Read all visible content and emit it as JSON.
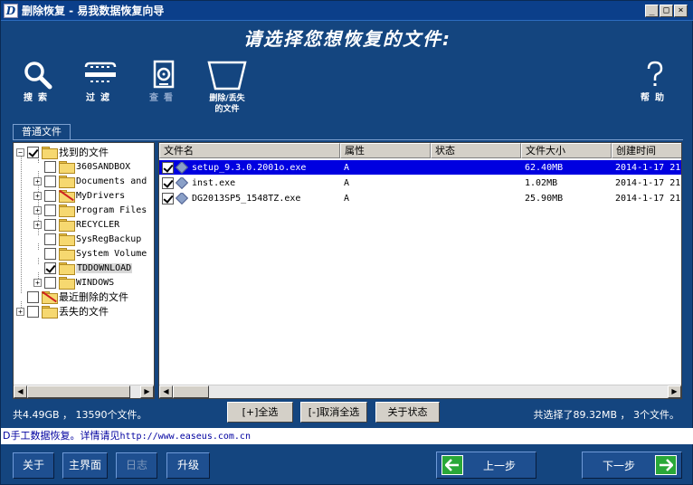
{
  "window": {
    "title": "删除恢复 - 易我数据恢复向导",
    "icon_letter": "D",
    "controls": [
      "_",
      "□",
      "×"
    ]
  },
  "banner": {
    "title": "请选择您想恢复的文件:"
  },
  "toolbar": {
    "search": {
      "label": "搜索",
      "icon": "magnifier-icon"
    },
    "filter": {
      "label": "过滤",
      "icon": "filter-icon"
    },
    "view": {
      "label": "查看",
      "icon": "view-disk-icon",
      "disabled": true
    },
    "deleted_lost": {
      "label_line1": "删除/丢失",
      "label_line2": "的文件",
      "icon": "funnel-icon"
    },
    "help": {
      "label": "帮助",
      "icon": "question-icon"
    }
  },
  "tab": {
    "label": "普通文件"
  },
  "tree": {
    "root_found": "找到的文件",
    "children": [
      {
        "label": "360SANDBOX",
        "expander": "none",
        "checked": false,
        "red": false
      },
      {
        "label": "Documents and",
        "expander": "+",
        "checked": false,
        "red": false
      },
      {
        "label": "MyDrivers",
        "expander": "+",
        "checked": false,
        "red": true
      },
      {
        "label": "Program Files",
        "expander": "+",
        "checked": false,
        "red": false
      },
      {
        "label": "RECYCLER",
        "expander": "+",
        "checked": false,
        "red": false
      },
      {
        "label": "SysRegBackup",
        "expander": "none",
        "checked": false,
        "red": false
      },
      {
        "label": "System Volume",
        "expander": "none",
        "checked": false,
        "red": false
      },
      {
        "label": "TDDOWNLOAD",
        "expander": "none",
        "checked": true,
        "red": false
      },
      {
        "label": "WINDOWS",
        "expander": "+",
        "checked": false,
        "red": false
      }
    ],
    "recent_deleted": "最近删除的文件",
    "lost_files": "丢失的文件"
  },
  "file_list": {
    "columns": [
      "文件名",
      "属性",
      "状态",
      "文件大小",
      "创建时间"
    ],
    "rows": [
      {
        "name": "setup_9.3.0.2001o.exe",
        "attr": "A",
        "status": "",
        "size": "62.40MB",
        "created": "2014-1-17 21:",
        "checked": true,
        "selected": true
      },
      {
        "name": "inst.exe",
        "attr": "A",
        "status": "",
        "size": "1.02MB",
        "created": "2014-1-17 21:",
        "checked": true,
        "selected": false
      },
      {
        "name": "DG2013SP5_1548TZ.exe",
        "attr": "A",
        "status": "",
        "size": "25.90MB",
        "created": "2014-1-17 21:",
        "checked": true,
        "selected": false
      }
    ]
  },
  "stats": {
    "left": "共4.49GB ， 13590个文件。",
    "right": "共选择了89.32MB ， 3个文件。"
  },
  "actions": {
    "select_all": "[+]全选",
    "deselect_all": "[-]取消全选",
    "about_status": "关于状态"
  },
  "status_strip": {
    "text": "D手工数据恢复。详情请见",
    "url": "http://www.easeus.com.cn"
  },
  "bottom": {
    "about": "关于",
    "main": "主界面",
    "log": "日志",
    "upgrade": "升级",
    "prev": "上一步",
    "next": "下一步"
  },
  "colors": {
    "background": "#14457f",
    "selected_row": "#0000e0",
    "arrow_green": "#2aa838"
  }
}
